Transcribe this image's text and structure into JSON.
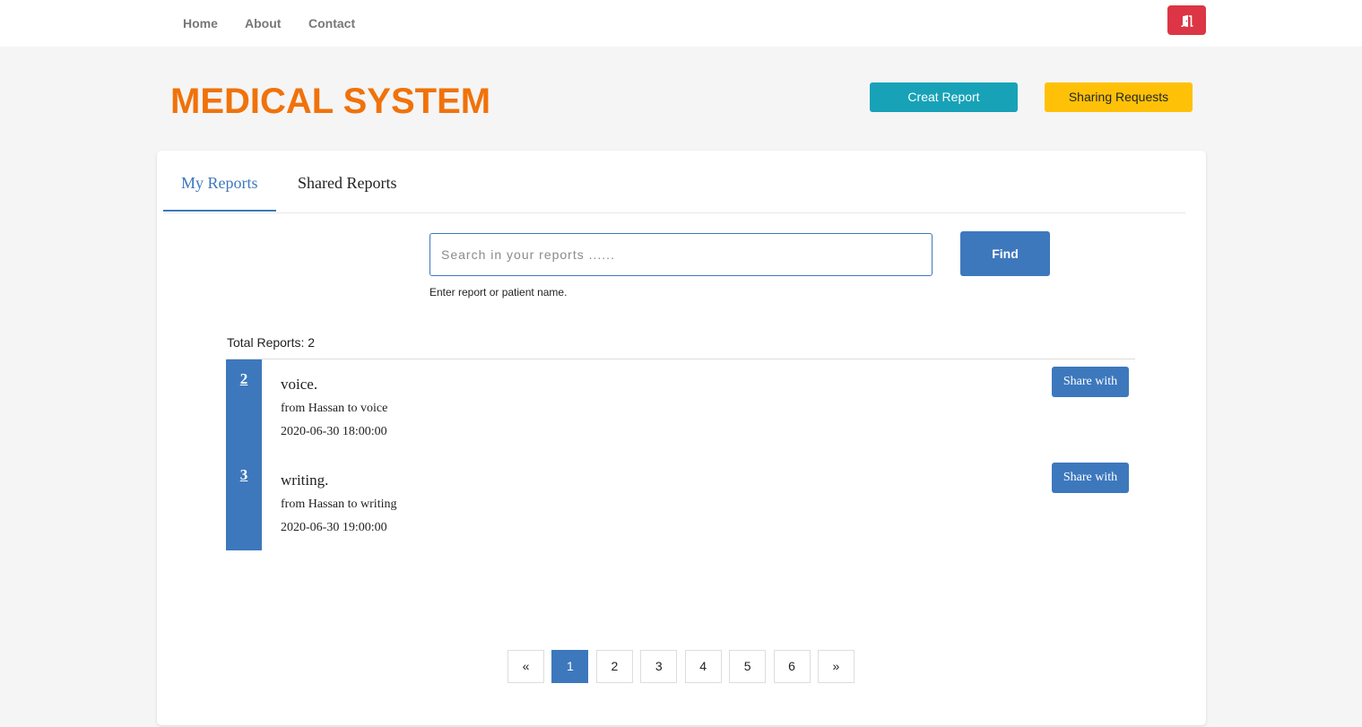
{
  "colors": {
    "brand": "#f0720a",
    "primary": "#3d78bd",
    "info": "#17a2b8",
    "warning": "#ffc107",
    "danger": "#dc3545"
  },
  "nav": {
    "links": [
      "Home",
      "About",
      "Contact"
    ],
    "logout_icon": "door-exit-icon"
  },
  "header": {
    "title": "MEDICAL SYSTEM",
    "create_report_label": "Creat Report",
    "sharing_requests_label": "Sharing Requests"
  },
  "tabs": [
    {
      "label": "My Reports",
      "active": true
    },
    {
      "label": "Shared Reports",
      "active": false
    }
  ],
  "search": {
    "placeholder": "Search in your reports ......",
    "button_label": "Find",
    "help_text": "Enter report or patient name."
  },
  "reports": {
    "total_label": "Total Reports:",
    "total_count": "2",
    "items": [
      {
        "id": "2",
        "title": "voice.",
        "description": "from Hassan to voice",
        "date": "2020-06-30 18:00:00",
        "share_label": "Share with"
      },
      {
        "id": "3",
        "title": "writing.",
        "description": "from Hassan to writing",
        "date": "2020-06-30 19:00:00",
        "share_label": "Share with"
      }
    ]
  },
  "pagination": {
    "prev": "«",
    "next": "»",
    "pages": [
      {
        "label": "1",
        "active": true
      },
      {
        "label": "2",
        "active": false
      },
      {
        "label": "3",
        "active": false
      },
      {
        "label": "4",
        "active": false
      },
      {
        "label": "5",
        "active": false
      },
      {
        "label": "6",
        "active": false
      }
    ]
  }
}
